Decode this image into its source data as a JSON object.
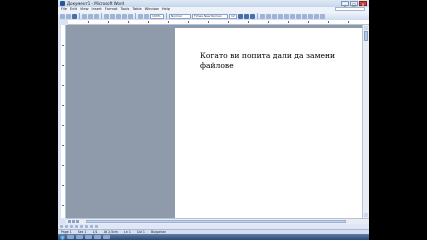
{
  "window": {
    "title": "Документ1 - Microsoft Word",
    "close_label": "x",
    "minimize_label": "_",
    "maximize_label": "□"
  },
  "menu": {
    "items": [
      "File",
      "Edit",
      "View",
      "Insert",
      "Format",
      "Tools",
      "Table",
      "Window",
      "Help"
    ],
    "help_placeholder": ""
  },
  "toolbar": {
    "style_value": "Normal",
    "font_value": "Times New Roman",
    "size_value": "12",
    "zoom_value": "100%"
  },
  "document": {
    "text": "Когато ви попита дали да замени файлове"
  },
  "statusbar": {
    "page": "Page 1",
    "section": "Sec 1",
    "page_of": "1/1",
    "position": "At 2,5cm",
    "line": "Ln 1",
    "column": "Col 1",
    "language": "Bulgarian"
  },
  "taskbar": {
    "time": "",
    "date": ""
  },
  "colors": {
    "doc_background": "#8f9aaa",
    "chrome": "#d9e3f3",
    "taskbar": "#2f4a74"
  }
}
